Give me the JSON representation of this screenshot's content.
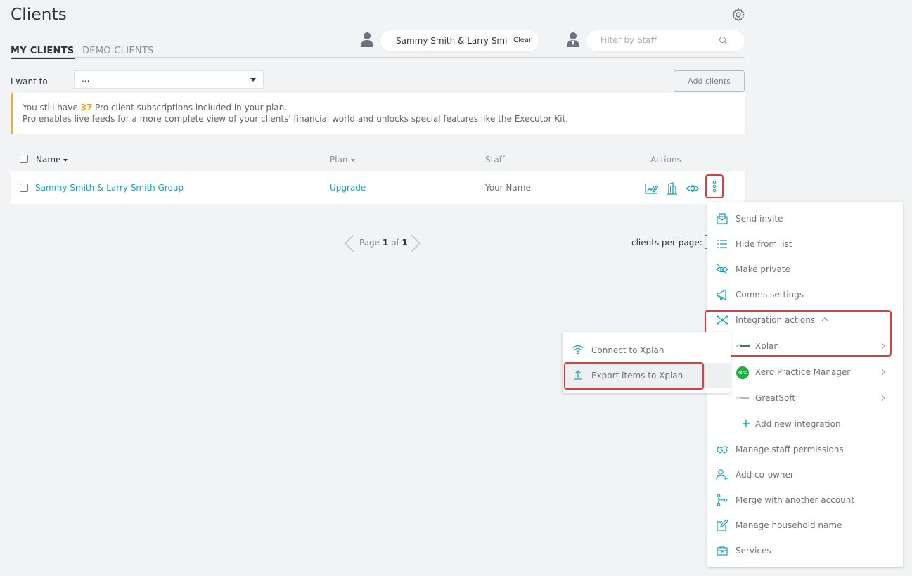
{
  "header": {
    "title": "Clients"
  },
  "tabs": [
    {
      "label": "MY CLIENTS",
      "active": true
    },
    {
      "label": "DEMO CLIENTS",
      "active": false
    }
  ],
  "client_filter": {
    "value": "Sammy Smith & Larry Smith Group",
    "clear_label": "Clear"
  },
  "staff_filter": {
    "placeholder": "Filter by Staff"
  },
  "toolbar": {
    "i_want_to_label": "I want to",
    "select_value": "...",
    "add_clients_label": "Add clients"
  },
  "banner": {
    "line1_prefix": "You still have ",
    "count": "37",
    "line1_suffix": " Pro client subscriptions included in your plan.",
    "line2": "Pro enables live feeds for a more complete view of your clients' financial world and unlocks special features like the Executor Kit."
  },
  "table": {
    "columns": {
      "name": "Name",
      "plan": "Plan",
      "staff": "Staff",
      "actions": "Actions"
    },
    "rows": [
      {
        "name": "Sammy Smith & Larry Smith Group",
        "plan": "Upgrade",
        "staff": "Your Name"
      }
    ]
  },
  "pagination": {
    "page_label": "Page",
    "current": "1",
    "of_label": "of",
    "total": "1",
    "per_page_label": "clients per page:"
  },
  "actions_menu": {
    "items": [
      {
        "label": "Send invite",
        "icon": "envelope-icon"
      },
      {
        "label": "Hide from list",
        "icon": "list-icon"
      },
      {
        "label": "Make private",
        "icon": "eye-slash-icon"
      },
      {
        "label": "Comms settings",
        "icon": "megaphone-icon"
      },
      {
        "label": "Integration actions",
        "icon": "network-icon"
      },
      {
        "label": "Xplan",
        "icon": "xplan-logo-icon"
      },
      {
        "label": "Xero Practice Manager",
        "icon": "xero-logo-icon"
      },
      {
        "label": "GreatSoft",
        "icon": "greatsoft-logo-icon"
      },
      {
        "label": "Add new integration",
        "icon": "plus-icon"
      },
      {
        "label": "Manage staff permissions",
        "icon": "handshake-icon"
      },
      {
        "label": "Add co-owner",
        "icon": "user-plus-icon"
      },
      {
        "label": "Merge with another account",
        "icon": "merge-icon"
      },
      {
        "label": "Manage household name",
        "icon": "edit-icon"
      },
      {
        "label": "Services",
        "icon": "briefcase-icon"
      }
    ]
  },
  "xplan_submenu": {
    "items": [
      {
        "label": "Connect to Xplan",
        "icon": "wifi-icon"
      },
      {
        "label": "Export items to Xplan",
        "icon": "upload-icon"
      }
    ]
  },
  "colors": {
    "accent": "#1b9fb8",
    "warning": "#f6b01e",
    "highlight": "#e23b3b",
    "xero": "#13b5ea"
  }
}
